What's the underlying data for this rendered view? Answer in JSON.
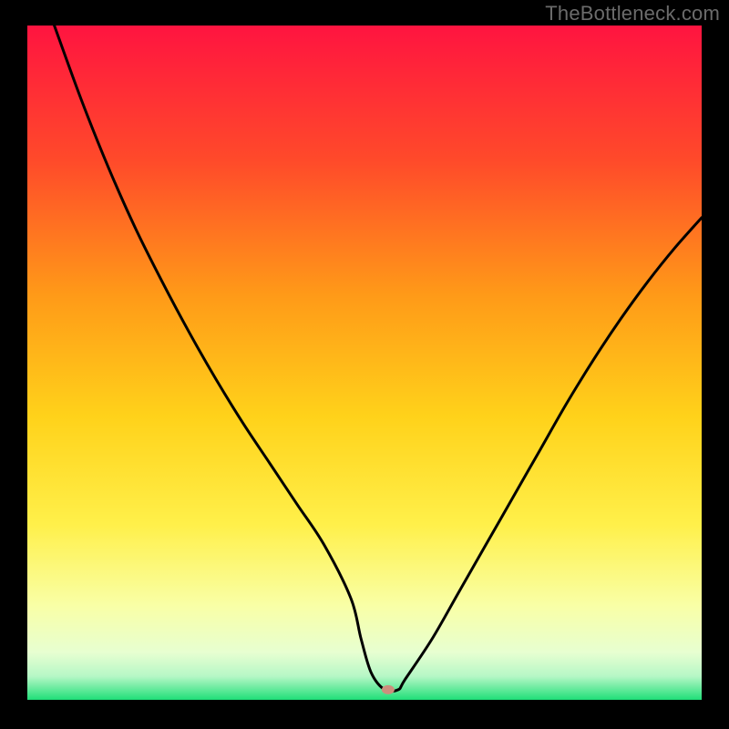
{
  "watermark": "TheBottleneck.com",
  "colors": {
    "background": "#000000",
    "gradient_top": "#ff1a3a",
    "gradient_mid": "#ffb500",
    "gradient_low": "#fff36a",
    "gradient_pale": "#f6ffe0",
    "gradient_bottom": "#24e07a",
    "curve_stroke": "#000000",
    "marker_fill": "#cc8f7d",
    "watermark_color": "#6b6b6b"
  },
  "chart_data": {
    "type": "line",
    "title": "",
    "xlabel": "",
    "ylabel": "",
    "xlim": [
      0,
      100
    ],
    "ylim": [
      0,
      100
    ],
    "grid": false,
    "legend": false,
    "annotations": [],
    "marker": {
      "x": 53.5,
      "y": 1.5
    },
    "series": [
      {
        "name": "bottleneck-curve",
        "x": [
          4,
          8,
          12,
          16,
          20,
          24,
          28,
          32,
          36,
          40,
          44,
          48,
          49.5,
          51,
          53,
          55,
          56,
          60,
          64,
          68,
          72,
          76,
          80,
          84,
          88,
          92,
          96,
          100
        ],
        "y": [
          100,
          89,
          79,
          70,
          62,
          54.5,
          47.5,
          41,
          35,
          29,
          23,
          15,
          9,
          4,
          1.5,
          1.5,
          3,
          9,
          16,
          23,
          30,
          37,
          44,
          50.5,
          56.5,
          62,
          67,
          71.5
        ]
      }
    ],
    "background_gradient": {
      "direction": "vertical",
      "stops": [
        {
          "offset": 0.0,
          "color": "#ff1440"
        },
        {
          "offset": 0.2,
          "color": "#ff4a2a"
        },
        {
          "offset": 0.4,
          "color": "#ff9a18"
        },
        {
          "offset": 0.58,
          "color": "#ffd21a"
        },
        {
          "offset": 0.74,
          "color": "#fff04a"
        },
        {
          "offset": 0.86,
          "color": "#f9ffa6"
        },
        {
          "offset": 0.93,
          "color": "#e7ffd1"
        },
        {
          "offset": 0.965,
          "color": "#b6f7c6"
        },
        {
          "offset": 1.0,
          "color": "#20df78"
        }
      ]
    }
  }
}
